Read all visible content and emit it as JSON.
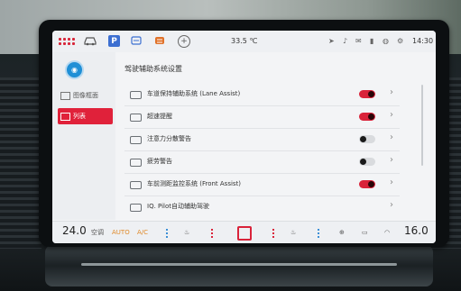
{
  "status_bar": {
    "temperature": "33.5 ℃",
    "time": "14:30"
  },
  "sidebar": {
    "items": [
      {
        "label": "图像框面"
      },
      {
        "label": "列表"
      }
    ]
  },
  "page_title": "驾驶辅助系统设置",
  "settings": [
    {
      "label": "车道保持辅助系统 (Lane Assist)",
      "toggle": "on",
      "icon": "lane-icon"
    },
    {
      "label": "超速提醒",
      "toggle": "on",
      "icon": "speed-icon"
    },
    {
      "label": "注意力分散警告",
      "toggle": "off",
      "icon": "eye-icon"
    },
    {
      "label": "疲劳警告",
      "toggle": "off",
      "icon": "eye-icon"
    },
    {
      "label": "车前测距监控系统 (Front Assist)",
      "toggle": "on",
      "icon": "front-assist-icon"
    },
    {
      "label": "IQ. Pilot自动辅助驾驶",
      "toggle": null,
      "icon": "pilot-icon"
    }
  ],
  "climate": {
    "left_temp": "24.0",
    "ac_label": "空调",
    "auto_label": "AUTO",
    "ac_btn": "A/C",
    "right_temp": "16.0"
  },
  "colors": {
    "accent": "#d9233a",
    "screen_bg": "#f3f4f6"
  }
}
